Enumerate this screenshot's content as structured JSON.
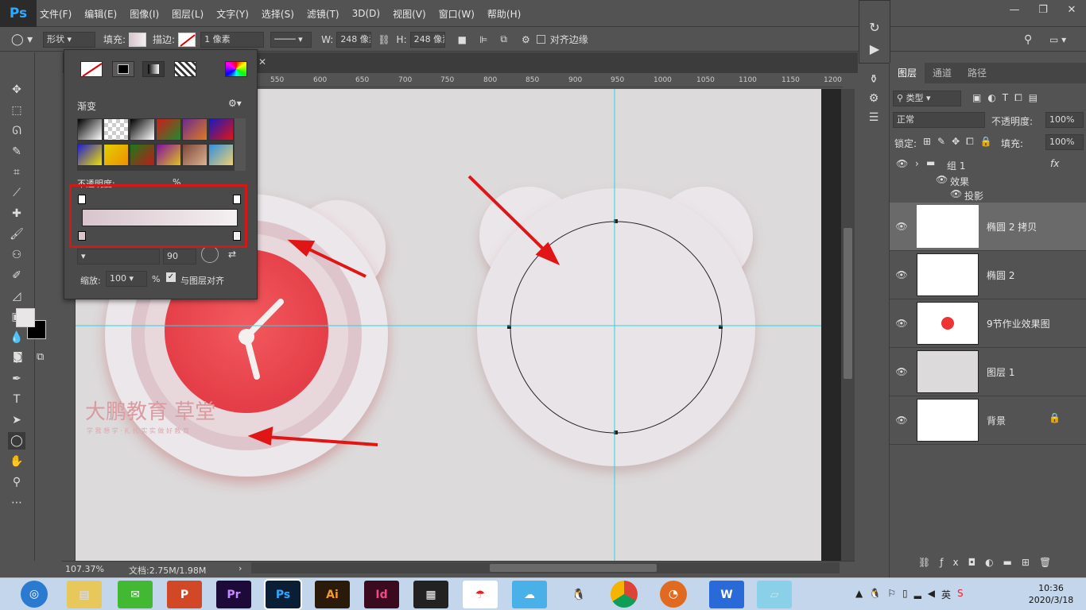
{
  "app": {
    "logo": "Ps"
  },
  "menu": [
    "文件(F)",
    "编辑(E)",
    "图像(I)",
    "图层(L)",
    "文字(Y)",
    "选择(S)",
    "滤镜(T)",
    "3D(D)",
    "视图(V)",
    "窗口(W)",
    "帮助(H)"
  ],
  "options": {
    "mode": "形状",
    "fill_label": "填充:",
    "stroke_label": "描边:",
    "stroke_width": "1 像素",
    "w_label": "W:",
    "w_value": "248 像素",
    "h_label": "H:",
    "h_value": "248 像素",
    "align_edges": "对齐边缘"
  },
  "ruler": {
    "ticks": [
      "550",
      "600",
      "650",
      "700",
      "750",
      "800",
      "850",
      "900",
      "950",
      "1000",
      "1050",
      "1100",
      "1150",
      "1200"
    ],
    "left_ticks": [
      "0",
      "5",
      "0",
      "0",
      "5",
      "0",
      "5",
      "0",
      "5"
    ]
  },
  "gradient_panel": {
    "title": "渐变",
    "opacity_label": "不透明度:",
    "opacity_unit": "%",
    "angle": "90",
    "scale_label": "缩放:",
    "scale_value": "100",
    "scale_unit": "%",
    "align_label": "与图层对齐",
    "presets": [
      [
        "#000000",
        "#ffffff"
      ],
      [
        "#aaaaaa",
        "#ffffff"
      ],
      [
        "#000000",
        "#ffffff"
      ],
      [
        "#d01b1b",
        "#1f8c2c"
      ],
      [
        "#6a2c91",
        "#e07a1f"
      ],
      [
        "#1919c0",
        "#e01515"
      ],
      [
        "#2020d0",
        "#f0e000"
      ],
      [
        "#e0d000",
        "#f09000"
      ],
      [
        "#1a7a1a",
        "#c01a1a"
      ],
      [
        "#8010a0",
        "#e0c020"
      ],
      [
        "#7a4a3a",
        "#e0b090"
      ],
      [
        "#3090e0",
        "#f0d070"
      ]
    ]
  },
  "canvas": {
    "watermark": "大鹏教育 草堂",
    "watermark_sub": "学 我 想 学 · 扎 扎 实 实 做 好 教 育"
  },
  "status": {
    "zoom": "107.37%",
    "doc": "文档:2.75M/1.98M"
  },
  "layers_panel": {
    "tabs": [
      "图层",
      "通道",
      "路径"
    ],
    "kind": "类型",
    "blend": "正常",
    "opacity_label": "不透明度:",
    "opacity": "100%",
    "lock_label": "锁定:",
    "fill_label": "填充:",
    "fill": "100%",
    "group": "组 1",
    "effects": "效果",
    "shadow": "投影",
    "fx": "fx",
    "layers": [
      {
        "name": "椭圆 2 拷贝"
      },
      {
        "name": "椭圆 2"
      },
      {
        "name": "9节作业效果图"
      },
      {
        "name": "图层 1"
      },
      {
        "name": "背景"
      }
    ]
  },
  "taskbar": {
    "time": "10:36",
    "date": "2020/3/18",
    "ime": "英",
    "apps": [
      {
        "label": "Ai",
        "bg": "#2a1a0a",
        "fg": "#f39b28"
      },
      {
        "label": "Id",
        "bg": "#3a0a1e",
        "fg": "#f04a85"
      },
      {
        "label": "Pr",
        "bg": "#1e0a38",
        "fg": "#c58aff"
      },
      {
        "label": "Ps",
        "bg": "#0a1e36",
        "fg": "#31a8ff"
      }
    ]
  }
}
